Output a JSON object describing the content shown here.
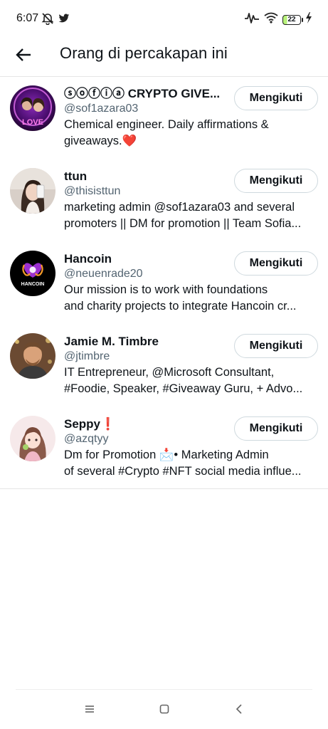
{
  "status_bar": {
    "time": "6:07",
    "battery_level": "22",
    "left_icons": [
      "mute-alarm-icon",
      "twitter-bird-icon"
    ],
    "right_icons": [
      "activity-pulse-icon",
      "wifi-icon",
      "battery-icon",
      "charging-bolt-icon"
    ]
  },
  "header": {
    "title": "Orang di percakapan ini",
    "back_icon": "arrow-left-icon"
  },
  "users": [
    {
      "name": "ⓢⓞⓕⓘⓐ CRYPTO GIVE...",
      "handle": "@sof1azara03",
      "bio_lines": [
        "Chemical engineer. Daily affirmations &",
        "giveaways.❤️"
      ],
      "button": "Mengikuti"
    },
    {
      "name": "ttun",
      "handle": "@thisisttun",
      "bio_lines": [
        "marketing admin @sof1azara03 and several",
        "promoters || DM for promotion || Team Sofia..."
      ],
      "button": "Mengikuti"
    },
    {
      "name": "Hancoin",
      "handle": "@neuenrade20",
      "bio_lines": [
        "Our mission is to work with foundations",
        "and charity projects to integrate Hancoin cr..."
      ],
      "button": "Mengikuti"
    },
    {
      "name": "Jamie M. Timbre",
      "handle": "@jtimbre",
      "bio_lines": [
        "IT Entrepreneur, @Microsoft Consultant,",
        "#Foodie, Speaker, #Giveaway Guru, + Advo..."
      ],
      "button": "Mengikuti"
    },
    {
      "name": "Seppy❗",
      "handle": "@azqtyy",
      "bio_lines": [
        "Dm for Promotion 📩• Marketing Admin",
        "of several #Crypto #NFT social media influe..."
      ],
      "button": "Mengikuti"
    }
  ],
  "nav_bar": {
    "icons": [
      "menu-icon",
      "home-square-icon",
      "back-chevron-icon"
    ]
  },
  "colors": {
    "text_primary": "#0f1419",
    "text_secondary": "#536471",
    "border": "#cfd9de",
    "heart": "#e0245e"
  }
}
